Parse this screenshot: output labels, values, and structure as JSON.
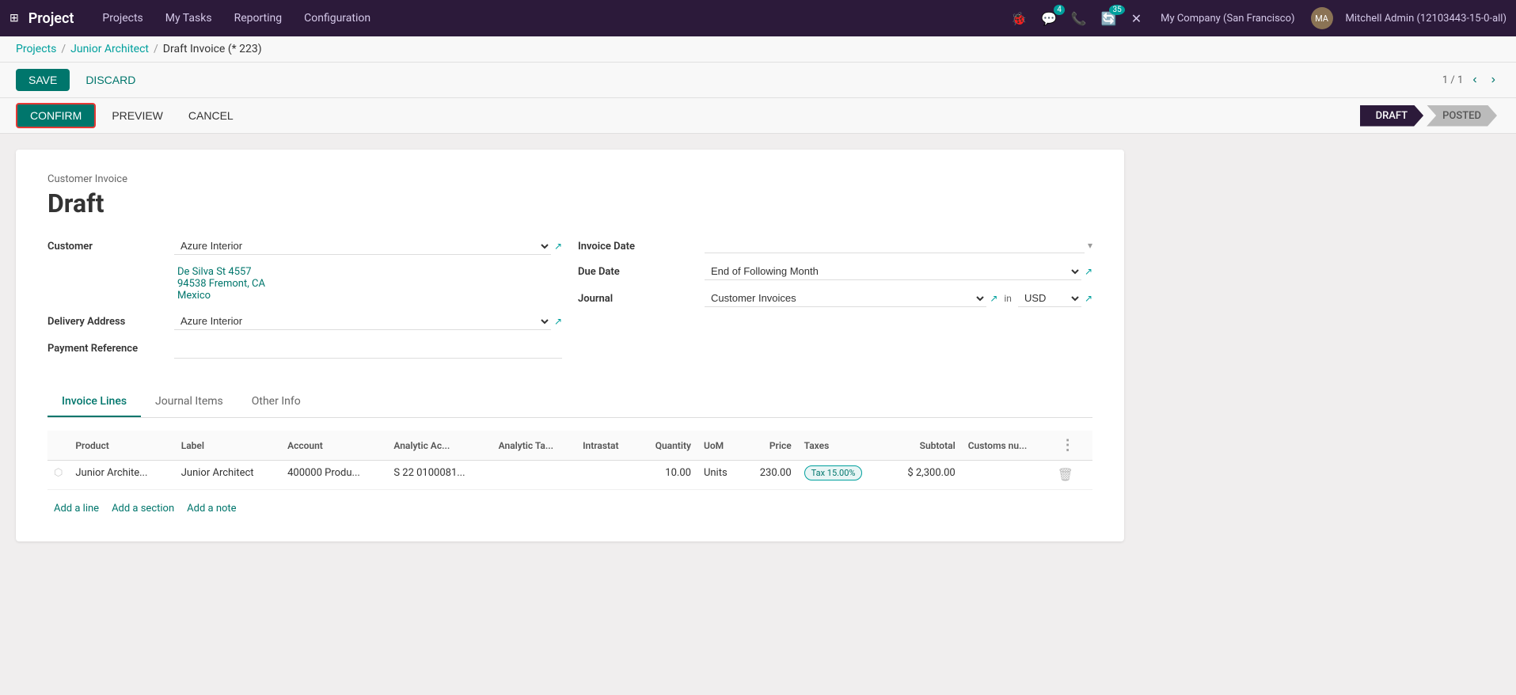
{
  "app": {
    "name": "Project",
    "grid_icon": "⋮⋮⋮"
  },
  "nav": {
    "links": [
      "Projects",
      "My Tasks",
      "Reporting",
      "Configuration"
    ],
    "active": "Reporting",
    "icons": [
      "🐞",
      "💬",
      "📞",
      "🔄",
      "🔧"
    ],
    "badge_chat": "4",
    "badge_refresh": "35",
    "company": "My Company (San Francisco)",
    "user": "Mitchell Admin (12103443-15-0-all)"
  },
  "breadcrumb": {
    "parts": [
      "Projects",
      "Junior Architect"
    ],
    "current": "Draft Invoice (* 223)"
  },
  "toolbar": {
    "save_label": "SAVE",
    "discard_label": "DISCARD",
    "pagination": "1 / 1"
  },
  "statusbar": {
    "confirm_label": "CONFIRM",
    "preview_label": "PREVIEW",
    "cancel_label": "CANCEL",
    "steps": [
      {
        "label": "DRAFT",
        "active": true
      },
      {
        "label": "POSTED",
        "active": false
      }
    ]
  },
  "invoice": {
    "type_label": "Customer Invoice",
    "status": "Draft",
    "customer_label": "Customer",
    "customer_value": "Azure Interior",
    "customer_address": [
      "De Silva St 4557",
      "94538 Fremont, CA",
      "Mexico"
    ],
    "delivery_address_label": "Delivery Address",
    "delivery_address_value": "Azure Interior",
    "payment_reference_label": "Payment Reference",
    "invoice_date_label": "Invoice Date",
    "invoice_date_value": "",
    "due_date_label": "Due Date",
    "due_date_value": "End of Following Month",
    "journal_label": "Journal",
    "journal_value": "Customer Invoices",
    "currency_value": "USD"
  },
  "tabs": [
    {
      "label": "Invoice Lines",
      "active": true
    },
    {
      "label": "Journal Items",
      "active": false
    },
    {
      "label": "Other Info",
      "active": false
    }
  ],
  "table": {
    "columns": [
      "Product",
      "Label",
      "Account",
      "Analytic Ac...",
      "Analytic Ta...",
      "Intrastat",
      "Quantity",
      "UoM",
      "Price",
      "Taxes",
      "Subtotal",
      "Customs nu..."
    ],
    "rows": [
      {
        "product": "Junior Archite...",
        "label": "Junior Architect",
        "account": "400000 Produ...",
        "analytic_ac": "S 22 0100081...",
        "analytic_ta": "",
        "intrastat": "",
        "quantity": "10.00",
        "uom": "Units",
        "price": "230.00",
        "taxes": "Tax 15.00%",
        "subtotal": "$ 2,300.00",
        "customs": ""
      }
    ],
    "add_links": [
      "Add a line",
      "Add a section",
      "Add a note"
    ]
  }
}
